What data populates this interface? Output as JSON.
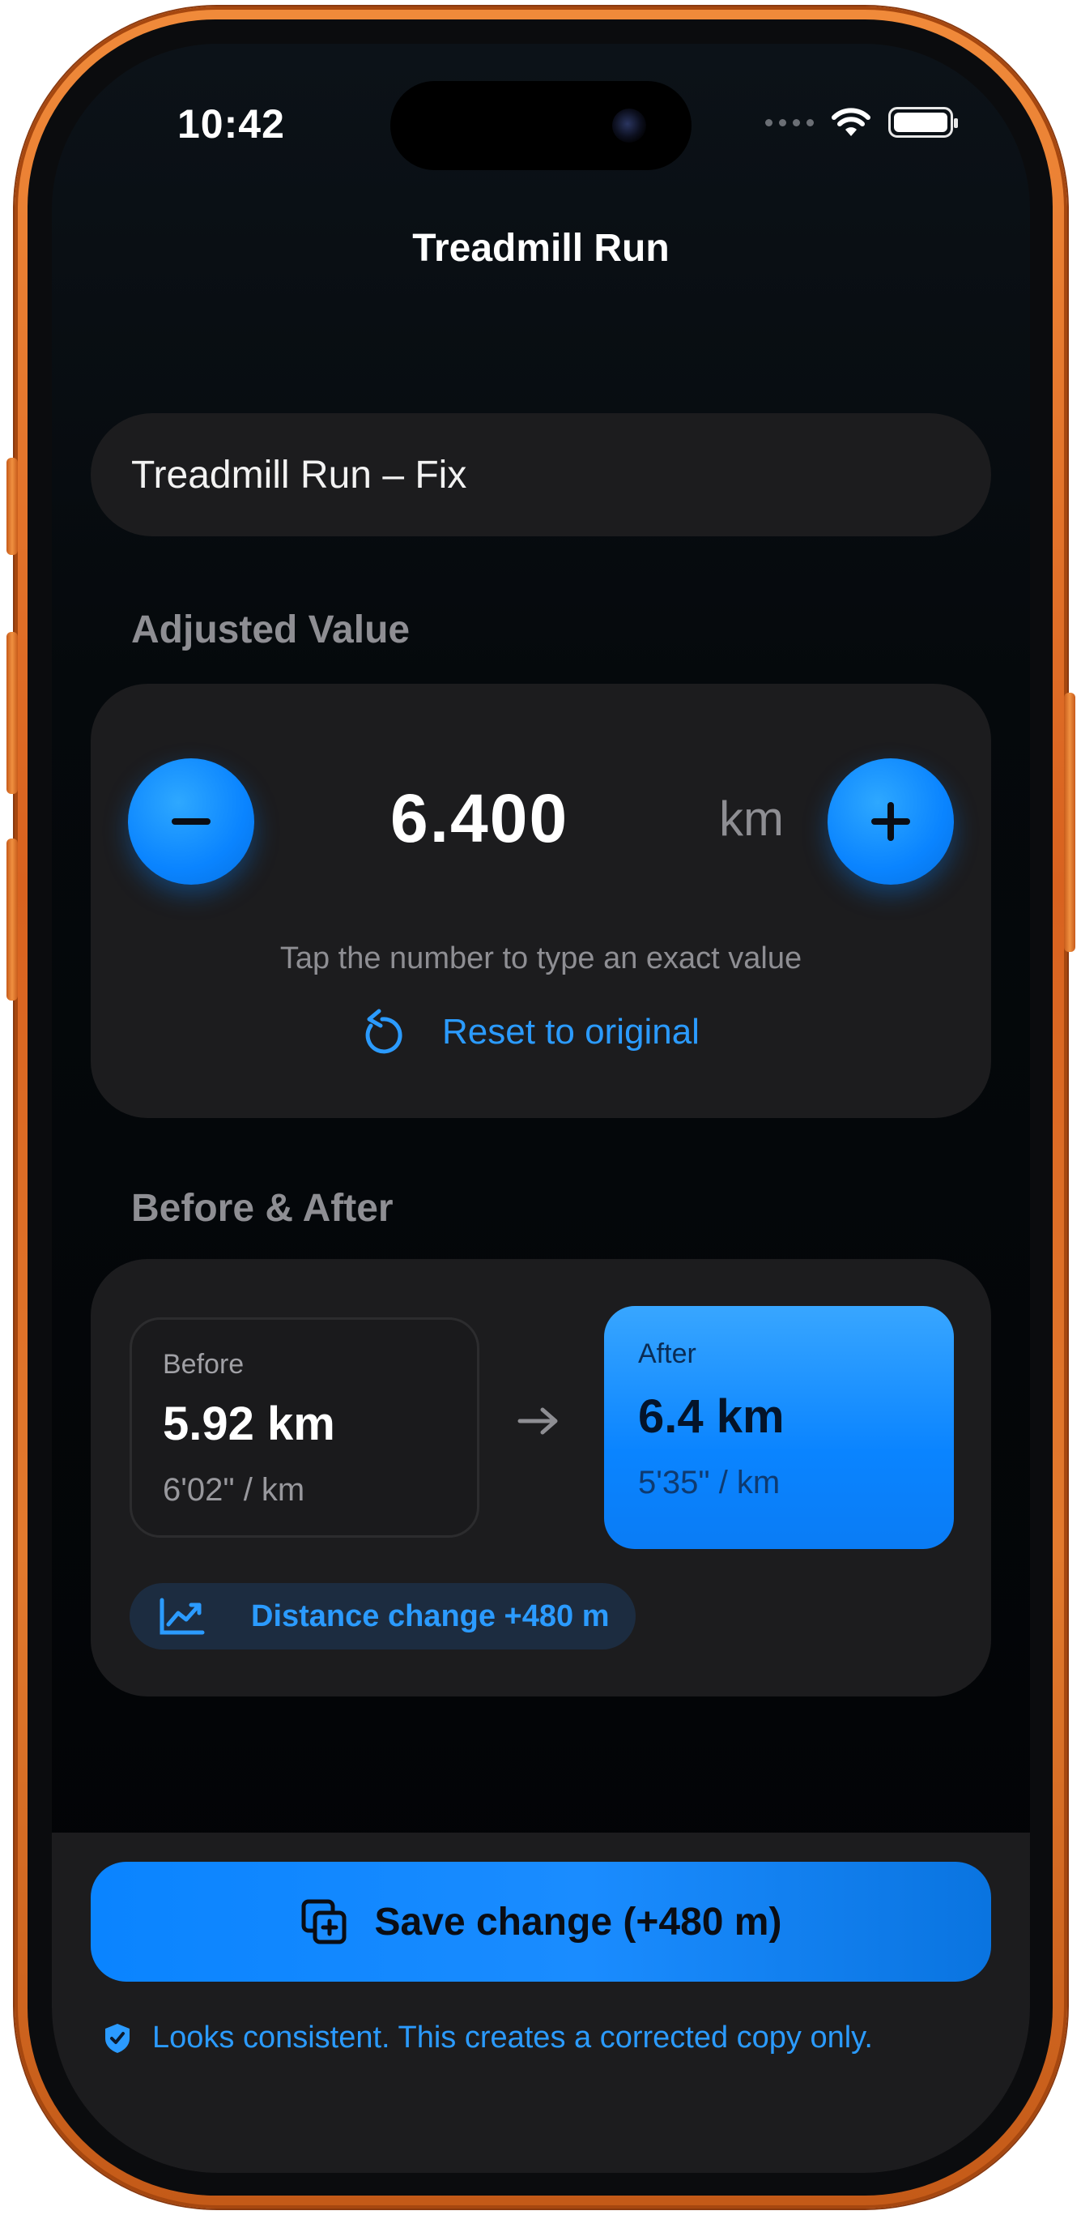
{
  "status": {
    "time": "10:42"
  },
  "nav": {
    "title": "Treadmill Run"
  },
  "name_field": {
    "value": "Treadmill Run – Fix"
  },
  "adjusted": {
    "section_label": "Adjusted Value",
    "value": "6.400",
    "unit": "km",
    "hint": "Tap the number to type an exact value",
    "reset_label": "Reset to original"
  },
  "compare": {
    "section_label": "Before & After",
    "before": {
      "label": "Before",
      "value": "5.92 km",
      "pace": "6'02\" / km"
    },
    "after": {
      "label": "After",
      "value": "6.4 km",
      "pace": "5'35\" / km"
    },
    "change_label": "Distance change +480 m"
  },
  "footer": {
    "save_label": "Save change (+480 m)",
    "note": "Looks consistent. This creates a corrected copy only."
  },
  "colors": {
    "accent": "#0a84ff",
    "frame": "#e0762a",
    "card": "#1c1c1e"
  }
}
